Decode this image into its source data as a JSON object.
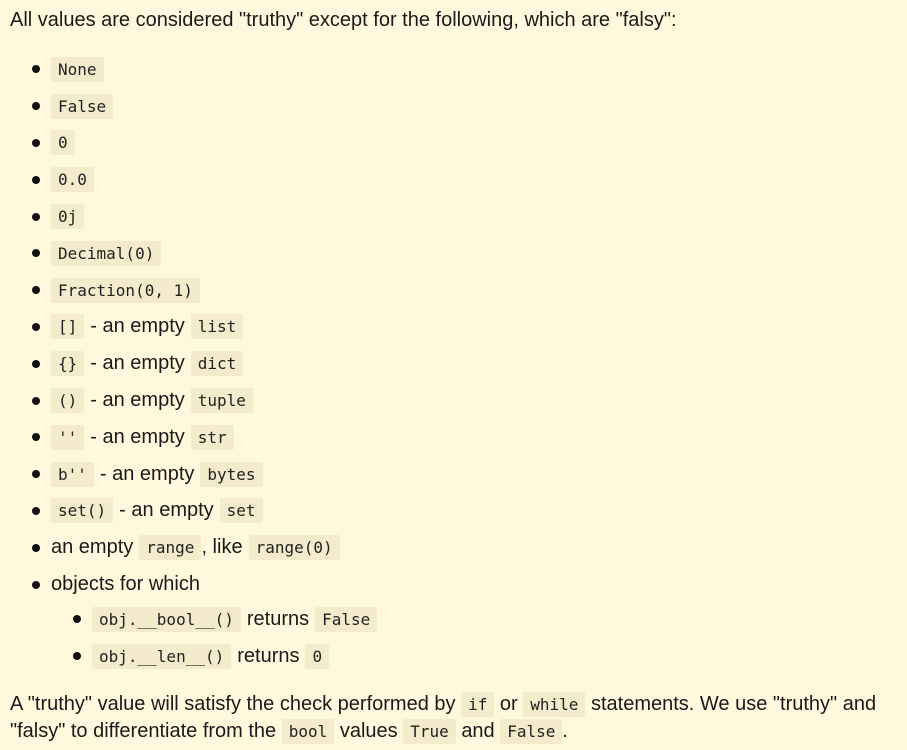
{
  "intro": "All values are considered \"truthy\" except for the following, which are \"falsy\":",
  "items": [
    {
      "code": "None"
    },
    {
      "code": "False"
    },
    {
      "code": "0"
    },
    {
      "code": "0.0"
    },
    {
      "code": "0j"
    },
    {
      "code": "Decimal(0)"
    },
    {
      "code": "Fraction(0, 1)"
    },
    {
      "code": "[]",
      "text": "- an empty",
      "code2": "list"
    },
    {
      "code": "{}",
      "text": "- an empty",
      "code2": "dict"
    },
    {
      "code": "()",
      "text": "- an empty",
      "code2": "tuple"
    },
    {
      "code": "''",
      "text": "- an empty",
      "code2": "str"
    },
    {
      "code": "b''",
      "text": "- an empty",
      "code2": "bytes"
    },
    {
      "code": "set()",
      "text": "- an empty",
      "code2": "set"
    }
  ],
  "range_item": {
    "text1": "an empty",
    "code1": "range",
    "text2": ", like",
    "code2": "range(0)"
  },
  "objects_item": {
    "text": "objects for which"
  },
  "sub_items": [
    {
      "code": "obj.__bool__()",
      "text": "returns",
      "code2": "False"
    },
    {
      "code": "obj.__len__()",
      "text": "returns",
      "code2": "0"
    }
  ],
  "outro": {
    "t1": "A \"truthy\" value will satisfy the check performed by",
    "c1": "if",
    "t2": "or",
    "c2": "while",
    "t3": "statements. We use \"truthy\" and \"falsy\" to differentiate from the",
    "c3": "bool",
    "t4": "values",
    "c4": "True",
    "t5": "and",
    "c5": "False",
    "t6": "."
  }
}
